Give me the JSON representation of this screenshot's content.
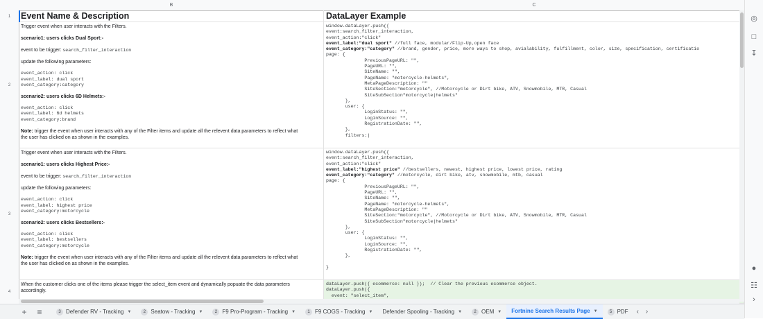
{
  "columns": [
    "B",
    "C"
  ],
  "rows": [
    "1",
    "2",
    "3",
    "4"
  ],
  "header": {
    "col_b": "Event Name & Description",
    "col_c": "DataLayer Example"
  },
  "row2": {
    "b": {
      "l1": "Trigger event when user interacts with the Filters.",
      "l2": "scenario1: users clicks Dual Sport:-",
      "l3a": "event to be trigger: ",
      "l3b": "search_filter_interaction",
      "l4": "update the following parameters:",
      "l5": "event_action: click\nevent_label: dual sport\nevent_category:category",
      "l6": "scenario2: users clicks 6D Helmets:-",
      "l7": "event_action: click\nevent_label: 6d helmets\nevent_category:brand",
      "note_label": "Note:",
      "note_text": " trigger the event when user interacts with any of the Filter items and update all the relevent data parameters to reflect what\nthe user has clicked on as shown in the examples."
    },
    "c": {
      "l1": "window.dataLayer.push({",
      "k1": "event:search_filter_interaction,",
      "k2": "event_action:\"click\"",
      "k3a": "event_label:\"dual sport\"",
      "k3b": " //full face, modular/Flip-Up,open face",
      "k4a": "event_category:\"category\"",
      "k4b": " //brand, gender, price, more ways to shop, avialability, fulfillment, color, size, specification, certificatio",
      "rest": "page: {\n              PreviousPageURL: \"\",\n              PageURL: \"\",\n              SiteName: \"\",\n              PageName: \"motorcycle-helmets\",\n              MetaPageDescription: \"\"\n              SiteSection:\"motorcycle\", //Motorcycle or Dirt bike, ATV, Snowmobile, MTR, Casual\n              SiteSubSection\"motorcycle|helmets\"\n       },\n       user: {\n              LoginStatus: \"\",\n              LoginSource: \"\",\n              RegistrationDate: \"\",\n       },\n       filters:|"
    }
  },
  "row3": {
    "b": {
      "l1": "Trigger event when user interacts with the Filters.",
      "l2": "scenario1: users clicks Highest Price:-",
      "l3a": "event to be trigger: ",
      "l3b": "search_filter_interaction",
      "l4": "update the following parameters:",
      "l5": "event_action: click\nevent_label: highest price\nevent_category:motorcycle",
      "l6": "scenario2: users clicks Bestsellers:-",
      "l7": "event_action: click\nevent_label: bestsellers\nevent_category:motorcycle",
      "note_label": "Note:",
      "note_text": " trigger the event when user interacts with any of the Filter items and update all the relevent data parameters to reflect what\nthe user has clicked on as shown in the examples."
    },
    "c": {
      "l1": "window.dataLayer.push({",
      "k1": "event:search_filter_interaction,",
      "k2": "event_action:\"click\"",
      "k3a": "event_label:\"highest price\"",
      "k3b": " //bestsellers, newest, highest price, lowest price, rating",
      "k4a": "event_category:\"category\"",
      "k4b": " //motorcycle, dirt bike, atv, snowmobile, mtb, casual",
      "rest": "page: {\n              PreviousPageURL: \"\",\n              PageURL: \"\",\n              SiteName: \"\",\n              PageName: \"motorcycle-helmets\",\n              MetaPageDescription: \"\"\n              SiteSection:\"motorcycle\", //Motorcycle or Dirt bike, ATV, Snowmobile, MTR, Casual\n              SiteSubSection\"motorcycle|helmets\"\n       },\n       user: {\n              LoginStatus: \"\",\n              LoginSource: \"\",\n              RegistrationDate: \"\",\n       },\n\n}"
    }
  },
  "row4": {
    "b": "When the customer clicks one of the items please trigger the select_item event and dynamically popuate the data parameters\naccordingly.",
    "c1": "dataLayer.push({ ecommerce: null });  // Clear the previous ecommerce object.",
    "c2": "dataLayer.push({",
    "c3": "  event: \"select_item\","
  },
  "tabs": [
    {
      "badge": "3",
      "label": "Defender RV - Tracking"
    },
    {
      "badge": "2",
      "label": "Seatow - Tracking"
    },
    {
      "badge": "2",
      "label": "F9 Pro-Program - Tracking"
    },
    {
      "badge": "1",
      "label": "F9 COGS - Tracking"
    },
    {
      "badge": "",
      "label": "Defender Spooling - Tracking"
    },
    {
      "badge": "2",
      "label": "OEM"
    },
    {
      "badge": "",
      "label": "Fortnine Search Results Page"
    },
    {
      "badge": "5",
      "label": "PDF"
    }
  ],
  "icons": {
    "add_sheet": "plus-icon",
    "all_sheets": "menu-icon",
    "scroll_left": "chevron-left-icon",
    "scroll_right": "chevron-right-icon"
  },
  "colors": {
    "active_tab": "#1a73e8",
    "green_row": "#e6f4e4"
  }
}
